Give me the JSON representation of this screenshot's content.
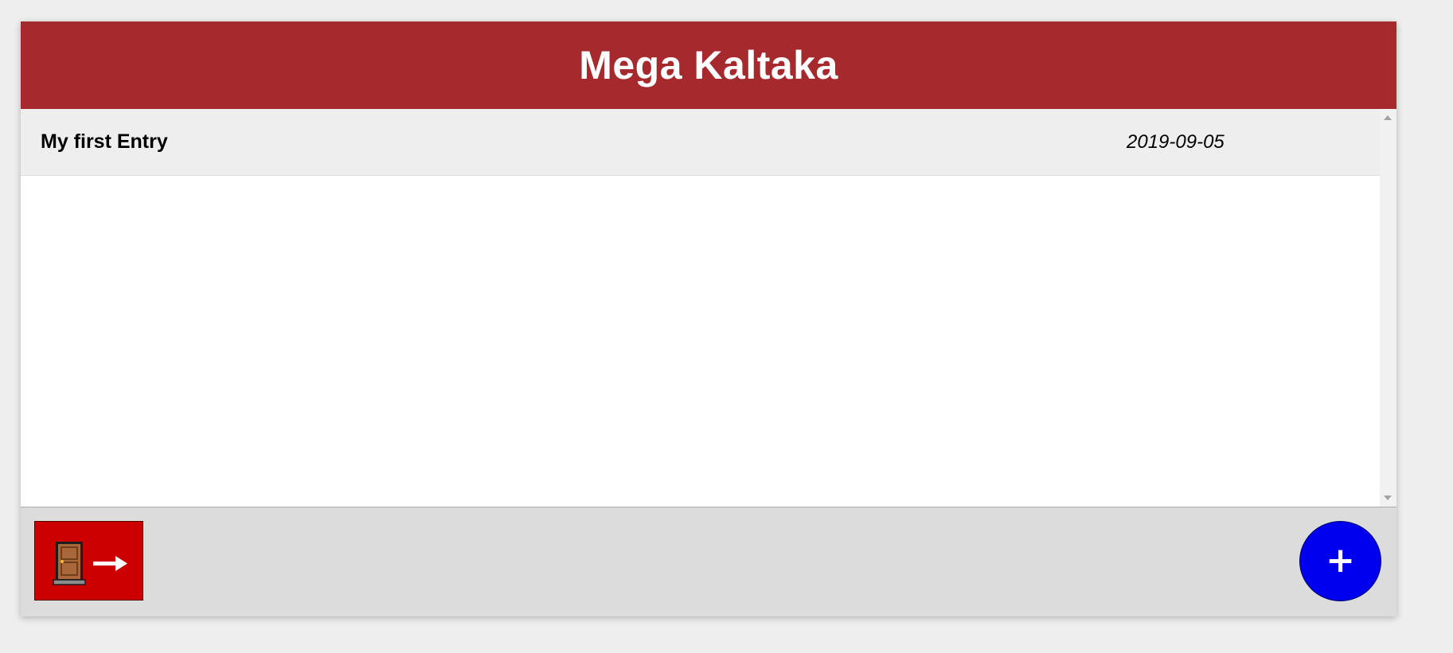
{
  "app": {
    "title": "Mega Kaltaka",
    "header_color": "#a5292d"
  },
  "entries": [
    {
      "title": "My first Entry",
      "date": "2019-09-05"
    }
  ],
  "footer": {
    "logout": {
      "icons": [
        "door-icon",
        "right-arrow-icon"
      ],
      "color": "#cc0000"
    },
    "add": {
      "label": "+",
      "icon": "plus-icon",
      "color": "#0000ee"
    }
  }
}
